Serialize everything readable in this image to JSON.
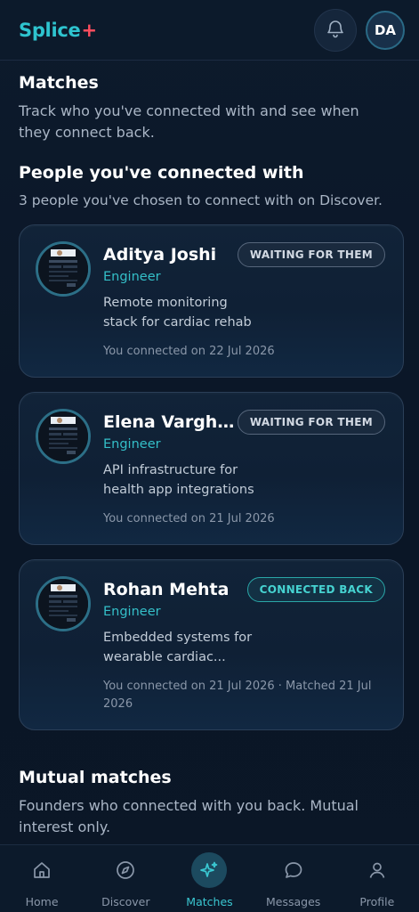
{
  "app": {
    "logo_text": "Splice",
    "logo_plus": "+",
    "brand_color": "#2ec4cf",
    "accent_color": "#ff4d5e"
  },
  "header": {
    "notification_icon": "bell-icon",
    "avatar_initials": "DA"
  },
  "page": {
    "title": "Matches",
    "subtitle": "Track who you've connected with and see when they connect back."
  },
  "connections": {
    "title": "People you've connected with",
    "subtitle": "3 people you've chosen to connect with on Discover.",
    "items": [
      {
        "name": "Aditya Joshi",
        "role": "Engineer",
        "pitch": "Remote monitoring stack for cardiac rehab",
        "meta": "You connected on 22 Jul 2026",
        "status": "WAITING FOR THEM",
        "status_type": "waiting"
      },
      {
        "name": "Elena Varghe...",
        "role": "Engineer",
        "pitch": "API infrastructure for health app integrations",
        "meta": "You connected on 21 Jul 2026",
        "status": "WAITING FOR THEM",
        "status_type": "waiting"
      },
      {
        "name": "Rohan Mehta",
        "role": "Engineer",
        "pitch": "Embedded systems for wearable cardiac...",
        "meta": "You connected on 21 Jul 2026 · Matched 21 Jul 2026",
        "status": "CONNECTED BACK",
        "status_type": "connected"
      }
    ]
  },
  "mutual": {
    "title": "Mutual matches",
    "subtitle": "Founders who connected with you back. Mutual interest only."
  },
  "nav": {
    "items": [
      {
        "label": "Home",
        "icon": "home-icon",
        "active": false
      },
      {
        "label": "Discover",
        "icon": "compass-icon",
        "active": false
      },
      {
        "label": "Matches",
        "icon": "sparkles-icon",
        "active": true
      },
      {
        "label": "Messages",
        "icon": "chat-bubble-icon",
        "active": false
      },
      {
        "label": "Profile",
        "icon": "user-icon",
        "active": false
      }
    ]
  }
}
